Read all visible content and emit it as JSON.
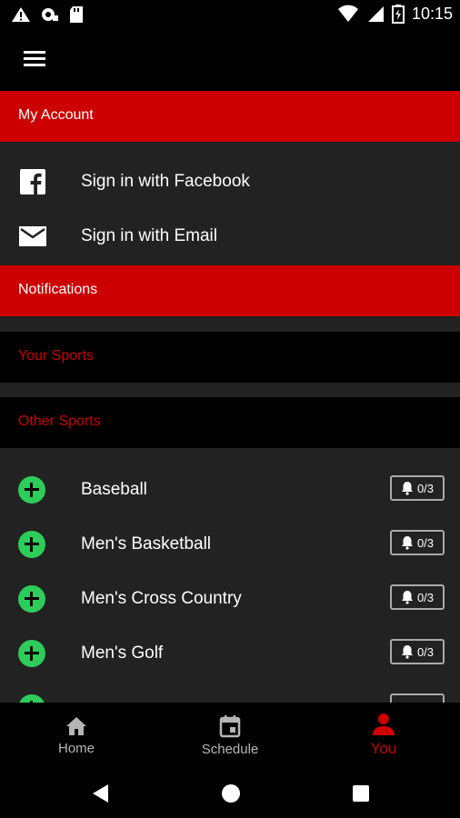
{
  "status_bar": {
    "time": "10:15"
  },
  "colors": {
    "accent": "#cc0000",
    "plus": "#2ecc5a",
    "background": "#222222"
  },
  "my_account": {
    "header": "My Account",
    "facebook_label": "Sign in with Facebook",
    "email_label": "Sign in with Email"
  },
  "notifications": {
    "header": "Notifications"
  },
  "your_sports": {
    "header": "Your Sports"
  },
  "other_sports": {
    "header": "Other Sports",
    "items": [
      {
        "label": "Baseball",
        "badge": "0/3"
      },
      {
        "label": "Men's Basketball",
        "badge": "0/3"
      },
      {
        "label": "Men's Cross Country",
        "badge": "0/3"
      },
      {
        "label": "Men's Golf",
        "badge": "0/3"
      }
    ]
  },
  "bottom_nav": {
    "home": "Home",
    "schedule": "Schedule",
    "you": "You"
  }
}
